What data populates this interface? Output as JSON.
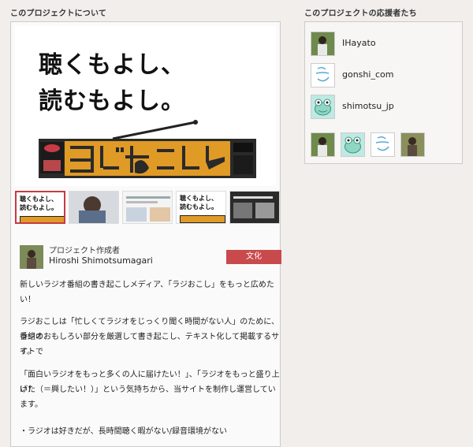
{
  "about_section": {
    "title": "このプロジェクトについて",
    "hero": {
      "line1": "聴くもよし、",
      "line2": "読むもよし。",
      "logo_text": "ラジおこし"
    },
    "thumbnails": [
      {
        "line1": "聴くもよし、",
        "line2": "読むもよし。"
      },
      {
        "caption": ""
      },
      {
        "caption": ""
      },
      {
        "line1": "聴くもよし、",
        "line2": "読むもよし。"
      },
      {
        "caption": ""
      }
    ],
    "creator": {
      "role": "プロジェクト作成者",
      "name": "Hiroshi Shimotsumagari"
    },
    "category": "文化",
    "description": [
      "新しいラジオ番組の書き起こしメディア、「ラジおこし」をもっと広めた",
      "い！",
      "ラジおこしは「忙しくてラジオをじっくり聞く時間がない人」のために、ラジオ",
      "番組のおもしろい部分を厳選して書き起こし、テキスト化して掲載するサイトで",
      "す。",
      "「面白いラジオをもっと多くの人に届けたい！」、「ラジオをもっと盛り上げた",
      "い！（＝興したい！）」という気持ちから、当サイトを制作し運営しています。",
      "・ラジオは好きだが、長時間聴く暇がない/録音環境がない"
    ]
  },
  "supporters_section": {
    "title": "このプロジェクトの応援者たち",
    "supporters": [
      {
        "name": "IHayato",
        "avatar_icon": "person-photo-icon"
      },
      {
        "name": "gonshi_com",
        "avatar_icon": "doodle-avatar-icon"
      },
      {
        "name": "shimotsu_jp",
        "avatar_icon": "frog-avatar-icon"
      }
    ],
    "mini_avatars": [
      "person-photo-icon",
      "frog-avatar-icon",
      "doodle-avatar-icon",
      "person-photo-icon"
    ]
  },
  "colors": {
    "accent_red": "#c94a4c",
    "logo_orange": "#e09a26",
    "background": "#f1eeec"
  }
}
